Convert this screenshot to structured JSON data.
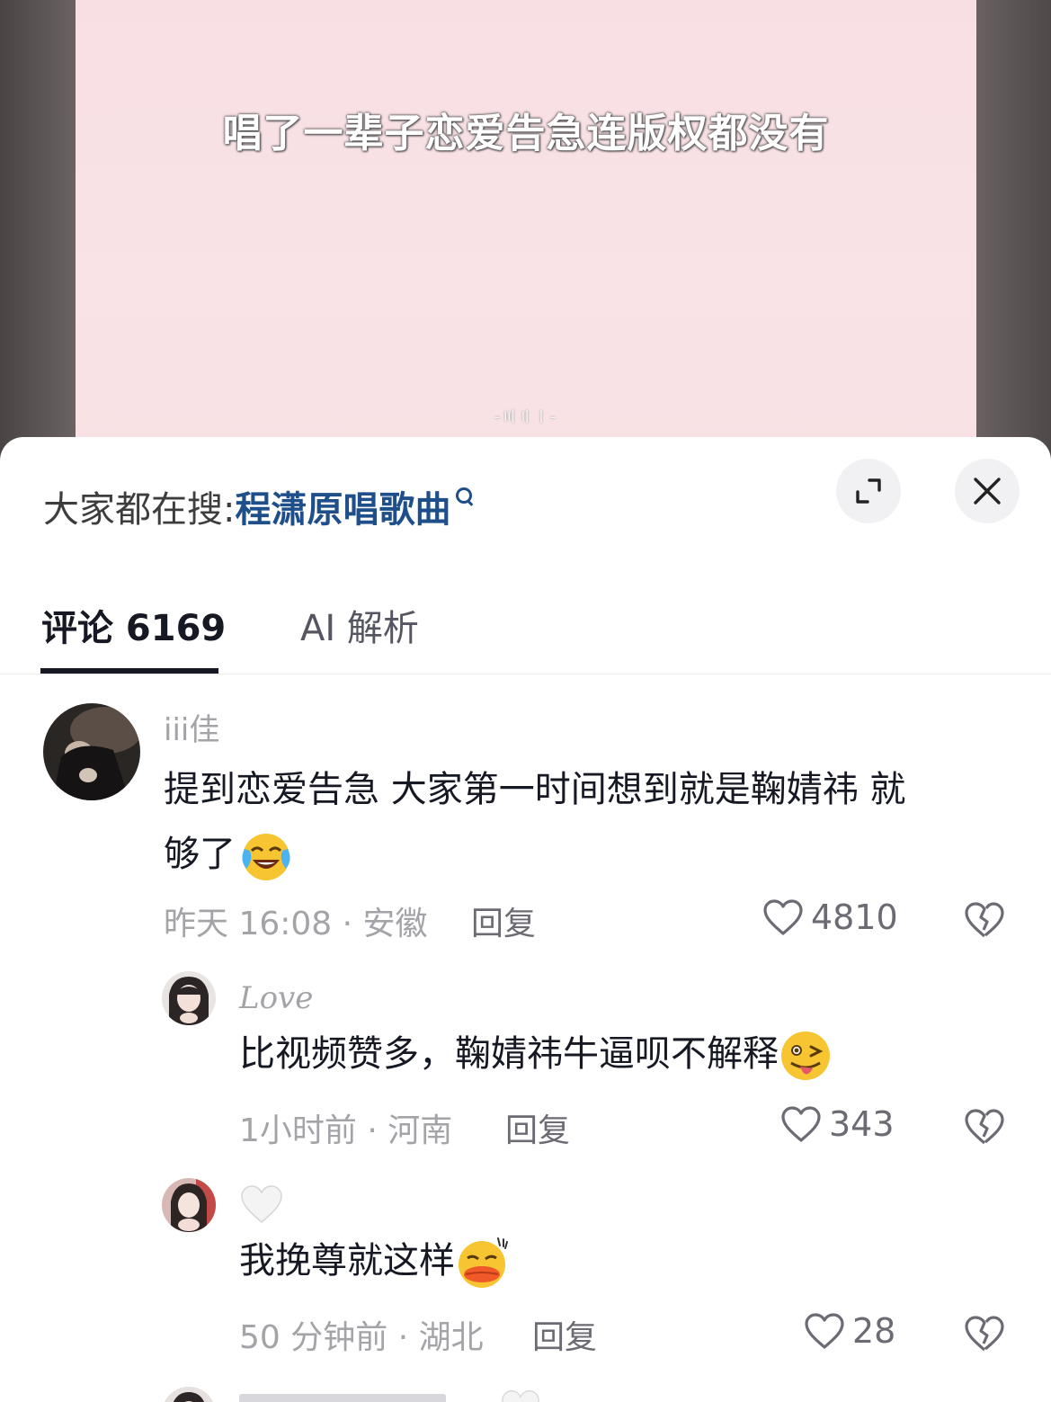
{
  "video": {
    "caption": "唱了一辈子恋爱告急连版权都没有",
    "watermark": "-〣〢〡-"
  },
  "sheet": {
    "search_prefix": "大家都在搜:",
    "search_term": "程潇原唱歌曲",
    "tabs": [
      {
        "label": "评论 6169",
        "active": true
      },
      {
        "label": "AI 解析",
        "active": false
      }
    ]
  },
  "comments": [
    {
      "username": "iii佳",
      "text_line1": "提到恋爱告急 大家第一时间想到就是鞠婧祎 就",
      "text_line2": "够了",
      "emoji": "crying-laughing-emoji",
      "time_location": "昨天 16:08 · 安徽",
      "reply_label": "回复",
      "likes": "4810"
    },
    {
      "username": "Love",
      "text": "比视频赞多，鞠婧祎牛逼呗不解释",
      "emoji": "winking-tongue-emoji",
      "time_location": "1小时前 · 河南",
      "reply_label": "回复",
      "likes": "343"
    },
    {
      "username": "🤍",
      "text": "我挽尊就这样",
      "emoji": "duck-lips-emoji",
      "time_location": "50 分钟前 · 湖北",
      "reply_label": "回复",
      "likes": "28"
    }
  ],
  "colors": {
    "accent_blue": "#1f4f8a",
    "text_dark": "#161823",
    "text_grey": "#a3a3a8",
    "video_pink": "#f9e3e6"
  }
}
